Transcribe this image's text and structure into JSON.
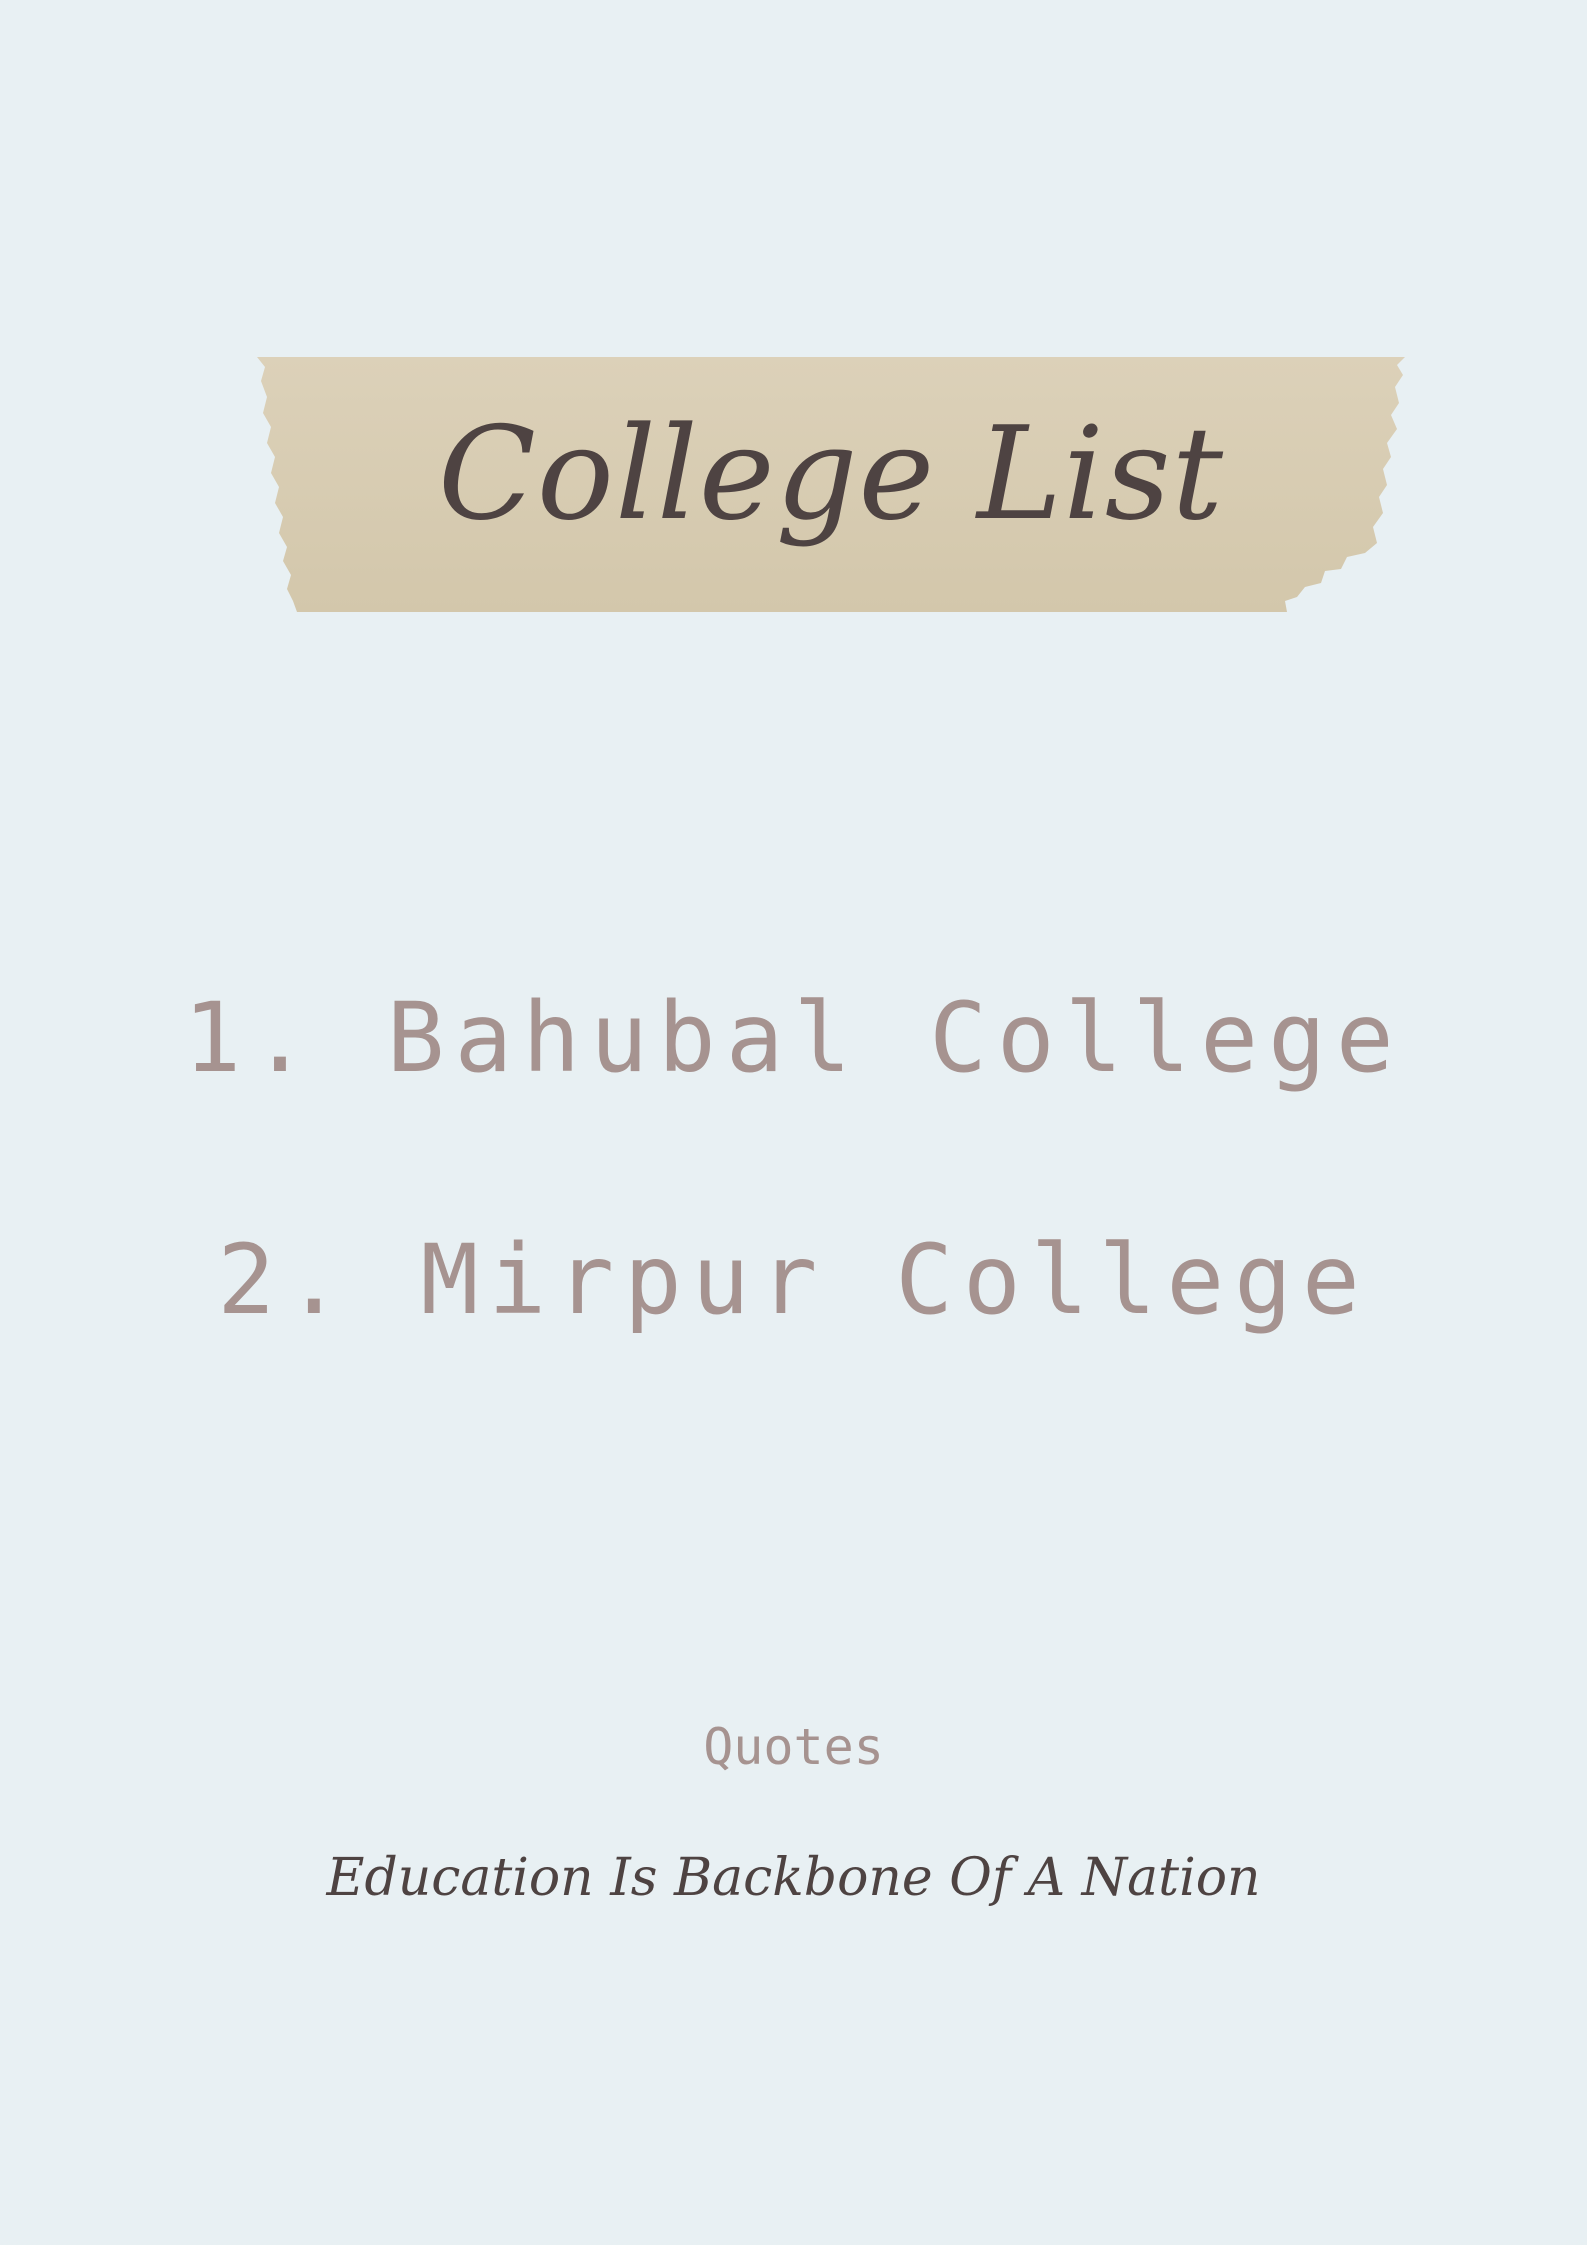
{
  "title": "College List",
  "colleges": [
    {
      "label": "1. Bahubal College"
    },
    {
      "label": "2. Mirpur College"
    }
  ],
  "quotes": {
    "label": "Quotes",
    "text": "Education Is Backbone Of A Nation"
  },
  "colors": {
    "background": "#e8f0f3",
    "tape": "#d8ccb2",
    "heading_text": "#4e4342",
    "list_text": "#a69390"
  }
}
